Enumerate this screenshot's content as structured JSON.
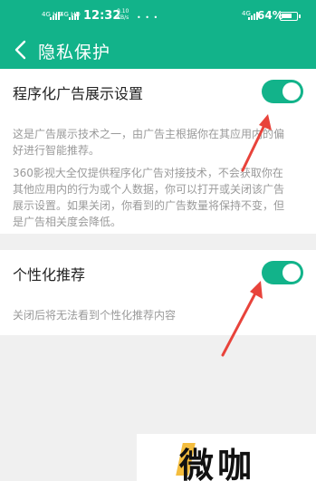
{
  "status_bar": {
    "sim1": "4G HD",
    "sim2": "4G HD",
    "time": "12:32",
    "speed_value": "0.10",
    "speed_unit": "KB/s",
    "network": "4G",
    "battery": "64%"
  },
  "header": {
    "title": "隐私保护"
  },
  "settings": [
    {
      "label": "程序化广告展示设置",
      "enabled": true,
      "description_lines": [
        "这是广告展示技术之一，由广告主根据你在其应用内的偏",
        "好进行智能推荐。"
      ],
      "description2_lines": [
        "360影视大全仅提供程序化广告对接技术，不会获取你在",
        "其他应用内的行为或个人数据，你可以打开或关闭该广告",
        "展示设置。如果关闭，你看到的广告数量将保持不变，但",
        "是广告相关度会降低。"
      ]
    },
    {
      "label": "个性化推荐",
      "enabled": true,
      "description_lines": [
        "关闭后将无法看到个性化推荐内容"
      ]
    }
  ],
  "watermark": {
    "text": "微咖"
  },
  "colors": {
    "accent": "#12b38a",
    "arrow": "#e8433b",
    "desc_text": "#9a9a9a"
  },
  "icons": {
    "back": "chevron-left-icon"
  }
}
